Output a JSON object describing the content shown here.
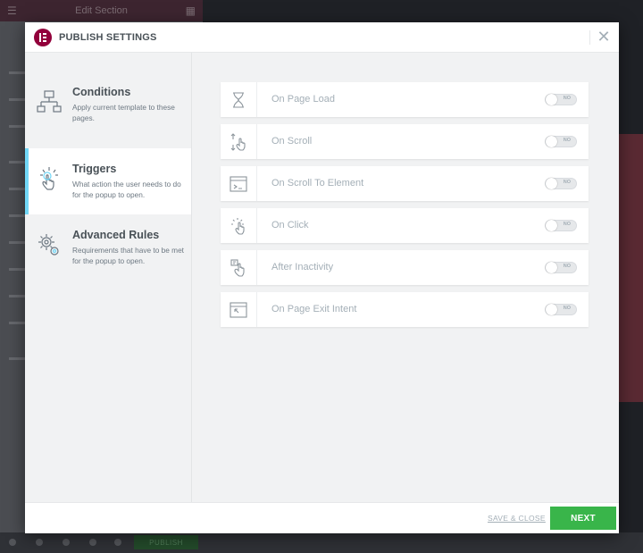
{
  "editor": {
    "panel_title": "Edit Section",
    "menu_icon": "hamburger-icon",
    "grid_icon": "grid-icon",
    "publish_label": "PUBLISH"
  },
  "modal": {
    "title": "PUBLISH SETTINGS",
    "logo_icon": "elementor-logo",
    "close_icon": "close-icon",
    "accent_color": "#71d7f7",
    "brand_color": "#92003b"
  },
  "sidebar": {
    "items": [
      {
        "title": "Conditions",
        "description": "Apply current template to these pages.",
        "icon": "sitemap-icon",
        "active": false
      },
      {
        "title": "Triggers",
        "description": "What action the user needs to do for the popup to open.",
        "icon": "hand-click-icon",
        "active": true
      },
      {
        "title": "Advanced Rules",
        "description": "Requirements that have to be met for the popup to open.",
        "icon": "gears-icon",
        "active": false
      }
    ]
  },
  "triggers": [
    {
      "label": "On Page Load",
      "icon": "hourglass-icon",
      "state": "NO"
    },
    {
      "label": "On Scroll",
      "icon": "scroll-hand-icon",
      "state": "NO"
    },
    {
      "label": "On Scroll To Element",
      "icon": "window-element-icon",
      "state": "NO"
    },
    {
      "label": "On Click",
      "icon": "click-hand-icon",
      "state": "NO"
    },
    {
      "label": "After Inactivity",
      "icon": "inactivity-hand-icon",
      "state": "NO"
    },
    {
      "label": "On Page Exit Intent",
      "icon": "exit-window-icon",
      "state": "NO"
    }
  ],
  "footer": {
    "save_close_label": "SAVE & CLOSE",
    "next_label": "NEXT",
    "next_color": "#39b54a"
  }
}
